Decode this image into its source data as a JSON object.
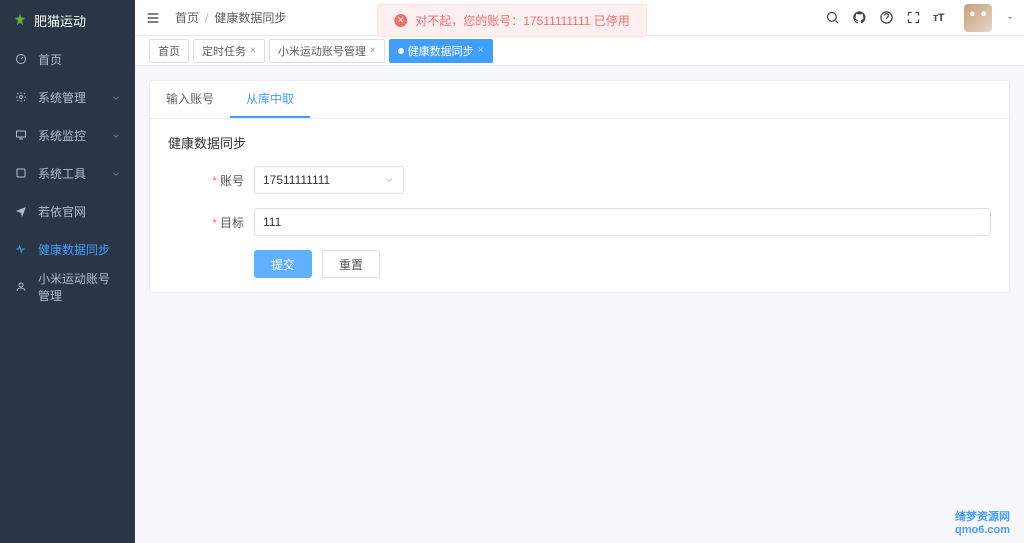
{
  "app_name": "肥猫运动",
  "alert": {
    "text": "对不起，您的账号：17511111111 已停用"
  },
  "breadcrumb": {
    "a": "首页",
    "b": "健康数据同步"
  },
  "sidebar": {
    "items": [
      {
        "icon": "gauge",
        "label": "首页"
      },
      {
        "icon": "gear",
        "label": "系统管理",
        "expand": true
      },
      {
        "icon": "monitor",
        "label": "系统监控",
        "expand": true
      },
      {
        "icon": "tool",
        "label": "系统工具",
        "expand": true
      },
      {
        "icon": "plane",
        "label": "若依官网"
      },
      {
        "icon": "pulse",
        "label": "健康数据同步",
        "active": true
      },
      {
        "icon": "user",
        "label": "小米运动账号管理"
      }
    ]
  },
  "tabs": [
    {
      "label": "首页"
    },
    {
      "label": "定时任务",
      "closable": true
    },
    {
      "label": "小米运动账号管理",
      "closable": true
    },
    {
      "label": "健康数据同步",
      "closable": true,
      "active": true
    }
  ],
  "inner_tabs": [
    {
      "label": "输入账号"
    },
    {
      "label": "从库中取",
      "active": true
    }
  ],
  "form": {
    "title": "健康数据同步",
    "account_label": "账号",
    "account_value": "17511111111",
    "target_label": "目标",
    "target_value": "111",
    "submit": "提交",
    "reset": "重置"
  },
  "watermark": {
    "l1": "绮梦资源网",
    "l2": "qmo6.com"
  }
}
